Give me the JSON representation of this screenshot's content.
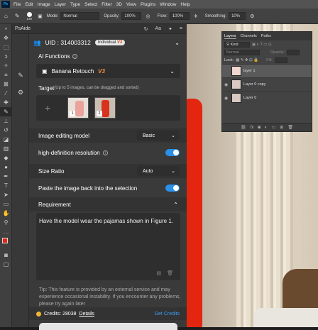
{
  "menubar": {
    "logo": "Ps",
    "items": [
      "File",
      "Edit",
      "Image",
      "Layer",
      "Type",
      "Select",
      "Filter",
      "3D",
      "View",
      "Plugins",
      "Window",
      "Help"
    ]
  },
  "options": {
    "brush_size": "139",
    "mode_label": "Mode:",
    "mode_value": "Normal",
    "opacity_label": "Opacity:",
    "opacity_value": "100%",
    "flow_label": "Flow:",
    "flow_value": "100%",
    "smoothing_label": "Smoothing:",
    "smoothing_value": "10%"
  },
  "layers_panel": {
    "tabs": [
      "Layers",
      "Channels",
      "Paths"
    ],
    "filter": "Kind",
    "blend": "Normal",
    "opacity_label": "Opacity:",
    "lock_label": "Lock:",
    "fill_label": "Fill:",
    "layers": [
      {
        "name": "layer 1"
      },
      {
        "name": "Layer 0 copy"
      },
      {
        "name": "Layer 0"
      }
    ]
  },
  "plugin": {
    "title": "PsAide",
    "uid_label": "UID : 314003312",
    "badge_text": "Individual",
    "badge_version": "V3",
    "ai_functions_label": "AI Functions",
    "function_name": "Banana Retouch",
    "function_version": "V3",
    "target_label": "Target",
    "target_hint": "(Up to 5 images, can be dragged and sorted)",
    "image_numbers": [
      "1",
      "2"
    ],
    "image_model_label": "Image editing model",
    "image_model_value": "Basic",
    "hd_label": "high-definition resolution",
    "hd_on": true,
    "size_ratio_label": "Size Ratio",
    "size_ratio_value": "Auto",
    "paste_back_label": "Paste the image back into the selection",
    "paste_back_on": true,
    "requirement_label": "Requirement",
    "requirement_text": "Have the model wear the pajamas shown in Figure 1.",
    "tip_text": "Tip: This feature is provided by an external service and may experience occasional instability. If you encounter any problems, please try again later",
    "credits_label": "Credits: 28038",
    "details_label": "Details",
    "get_credits_label": "Get Credits"
  },
  "colors": {
    "accent_blue": "#2a90e8",
    "version_orange": "#f5913a",
    "dress_red": "#e4250f"
  }
}
